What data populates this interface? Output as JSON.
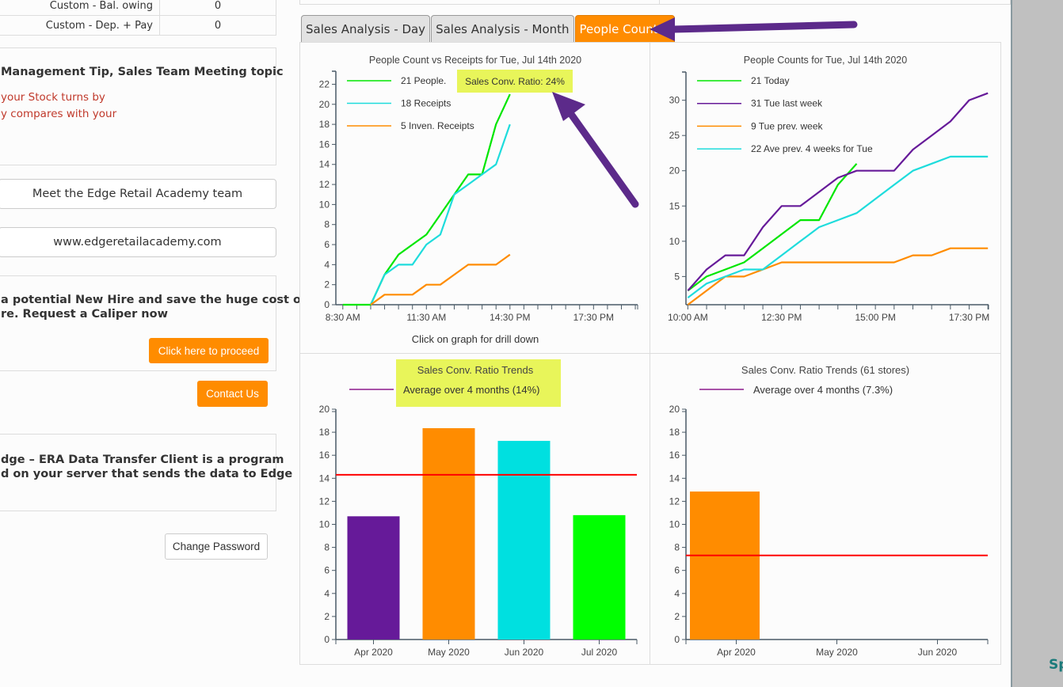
{
  "left": {
    "table": [
      {
        "label": "Custom - Bal. owing",
        "value": "0"
      },
      {
        "label": "Custom - Dep. + Pay",
        "value": "0"
      }
    ],
    "tip": {
      "title": "Management Tip, Sales Team Meeting topic",
      "lines": [
        "your Stock turns by",
        "y compares with your"
      ]
    },
    "links": [
      "Meet the Edge Retail Academy team",
      "www.edgeretailacademy.com"
    ],
    "caliper": {
      "lines": [
        "a potential New Hire and save the huge cost of",
        "re. Request a Caliper now"
      ],
      "button": "Click here to proceed"
    },
    "contact_button": "Contact Us",
    "era": {
      "lines": [
        "dge – ERA Data Transfer Client is a program",
        "d on your server that sends the data to Edge"
      ]
    },
    "change_password_button": "Change Password"
  },
  "tabs": [
    {
      "label": "Sales Analysis - Day",
      "active": false
    },
    {
      "label": "Sales Analysis - Month",
      "active": false
    },
    {
      "label": "People Counter",
      "active": true
    }
  ],
  "annotation": {
    "color": "#5c2a8a"
  },
  "colors": {
    "people": "#00e600",
    "receipts": "#1edcdc",
    "inven": "#ff8c00",
    "last_week": "#661a99",
    "avg_line": "#ff0000",
    "highlight": "#e8f55a",
    "axis": "#4a5a66",
    "orange": "#ff8c00"
  },
  "side": {
    "text": "Sp"
  },
  "chart_data": [
    {
      "type": "line",
      "title": "People Count vs Receipts for Tue, Jul 14th 2020",
      "badge": "Sales Conv. Ratio: 24%",
      "footnote": "Click on graph for drill down",
      "xlabel": "",
      "ylabel": "",
      "ylim": [
        0,
        23.3
      ],
      "yticks": [
        0,
        2,
        4,
        6,
        8,
        10,
        12,
        14,
        16,
        18,
        20,
        22
      ],
      "xlim_minutes": [
        495,
        1145
      ],
      "xtick_start": 510,
      "xtick_step": 30,
      "xtick_end": 1140,
      "xtick_labels": [
        {
          "min": 510,
          "label": "8:30 AM"
        },
        {
          "min": 690,
          "label": "11:30 AM"
        },
        {
          "min": 870,
          "label": "14:30 PM"
        },
        {
          "min": 1050,
          "label": "17:30 PM"
        }
      ],
      "series": [
        {
          "name": "21 People.",
          "color": "#00e600",
          "x": [
            510,
            540,
            570,
            600,
            630,
            660,
            690,
            720,
            750,
            780,
            810,
            840,
            870
          ],
          "values": [
            0,
            0,
            0,
            3,
            5,
            6,
            7,
            9,
            11,
            13,
            13,
            18,
            21
          ]
        },
        {
          "name": "18 Receipts",
          "color": "#1edcdc",
          "x": [
            570,
            600,
            630,
            660,
            690,
            720,
            750,
            780,
            810,
            840,
            870
          ],
          "values": [
            0,
            3,
            4,
            4,
            6,
            7,
            11,
            12,
            13,
            14,
            18
          ]
        },
        {
          "name": "5 Inven. Receipts",
          "color": "#ff8c00",
          "x": [
            570,
            600,
            630,
            660,
            690,
            720,
            750,
            780,
            810,
            840,
            870
          ],
          "values": [
            0,
            1,
            1,
            1,
            2,
            2,
            3,
            4,
            4,
            4,
            5
          ]
        }
      ]
    },
    {
      "type": "line",
      "title": "People Counts for Tue, Jul 14th 2020",
      "xlabel": "",
      "ylabel": "",
      "ylim": [
        1,
        34
      ],
      "yticks": [
        5,
        10,
        15,
        20,
        25,
        30
      ],
      "xlim_minutes": [
        597,
        1081
      ],
      "xtick_start": 600,
      "xtick_step": 30,
      "xtick_end": 1080,
      "xtick_labels": [
        {
          "min": 600,
          "label": "10:00 AM"
        },
        {
          "min": 750,
          "label": "12:30 PM"
        },
        {
          "min": 900,
          "label": "15:00 PM"
        },
        {
          "min": 1050,
          "label": "17:30 PM"
        }
      ],
      "series": [
        {
          "name": "21 Today",
          "color": "#00e600",
          "x": [
            600,
            630,
            660,
            690,
            720,
            750,
            780,
            810,
            840,
            870
          ],
          "values": [
            3,
            5,
            6,
            7,
            9,
            11,
            13,
            13,
            18,
            21
          ]
        },
        {
          "name": "31 Tue last week",
          "color": "#661a99",
          "x": [
            600,
            630,
            660,
            690,
            720,
            750,
            780,
            810,
            840,
            870,
            900,
            930,
            960,
            990,
            1020,
            1050,
            1080
          ],
          "values": [
            3,
            6,
            8,
            8,
            12,
            15,
            15,
            17,
            19,
            20,
            20,
            20,
            23,
            25,
            27,
            30,
            31
          ]
        },
        {
          "name": "9 Tue prev. week",
          "color": "#ff8c00",
          "x": [
            600,
            630,
            660,
            690,
            720,
            750,
            780,
            810,
            840,
            870,
            900,
            930,
            960,
            990,
            1020,
            1050,
            1080
          ],
          "values": [
            1,
            3,
            5,
            5,
            6,
            7,
            7,
            7,
            7,
            7,
            7,
            7,
            8,
            8,
            9,
            9,
            9
          ]
        },
        {
          "name": "22 Ave prev. 4 weeks for Tue",
          "color": "#1edcdc",
          "x": [
            600,
            630,
            660,
            690,
            720,
            750,
            780,
            810,
            840,
            870,
            900,
            930,
            960,
            990,
            1020,
            1050,
            1080
          ],
          "values": [
            2,
            4,
            5,
            6,
            6,
            8,
            10,
            12,
            13,
            14,
            16,
            18,
            20,
            21,
            22,
            22,
            22
          ]
        }
      ]
    },
    {
      "type": "bar",
      "title": "Sales Conv. Ratio Trends",
      "legend": "Average over 4 months (14%)",
      "highlighted": true,
      "categories": [
        "Apr 2020",
        "May 2020",
        "Jun 2020",
        "Jul 2020"
      ],
      "values": [
        10.7,
        18.35,
        17.25,
        10.8
      ],
      "bar_colors": [
        "#661a99",
        "#ff8c00",
        "#00e0e0",
        "#00ff00"
      ],
      "average": 14.3,
      "ylim": [
        0,
        20
      ],
      "yticks": [
        0,
        2,
        4,
        6,
        8,
        10,
        12,
        14,
        16,
        18,
        20
      ],
      "xlabel": "",
      "ylabel": ""
    },
    {
      "type": "bar",
      "title": "Sales Conv. Ratio Trends (61 stores)",
      "legend": "Average over 4 months (7.3%)",
      "highlighted": false,
      "categories": [
        "Apr 2020",
        "May 2020",
        "Jun 2020"
      ],
      "values": [
        12.85,
        null,
        null
      ],
      "bar_colors": [
        "#ff8c00",
        "#ff8c00",
        "#ff8c00"
      ],
      "average": 7.3,
      "ylim": [
        0,
        20
      ],
      "yticks": [
        0,
        2,
        4,
        6,
        8,
        10,
        12,
        14,
        16,
        18,
        20
      ],
      "xlabel": "",
      "ylabel": ""
    }
  ]
}
